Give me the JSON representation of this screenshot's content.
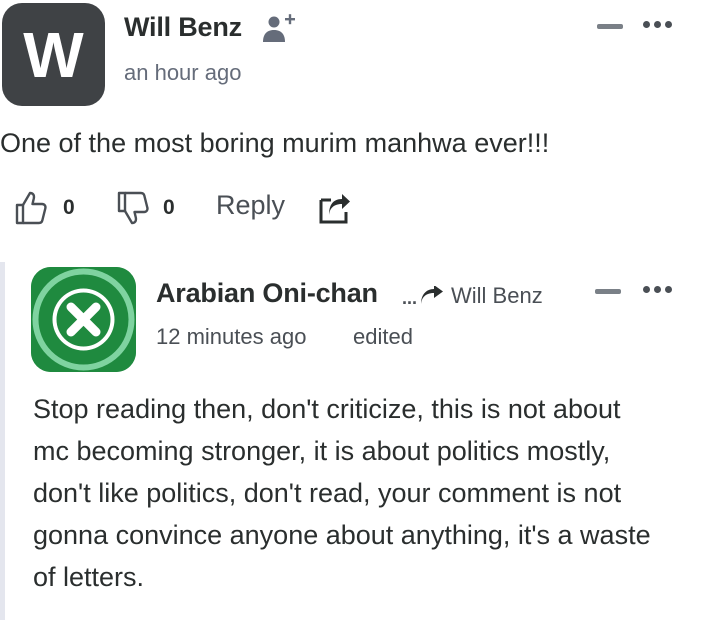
{
  "comment": {
    "avatar_letter": "W",
    "author": "Will Benz",
    "timestamp": "an hour ago",
    "text": "One of the most boring murim manhwa ever!!!",
    "likes": "0",
    "dislikes": "0",
    "reply_label": "Reply",
    "follow_icon": "follow-user-icon",
    "share_icon": "share-icon"
  },
  "reply": {
    "author": "Arabian Oni-chan",
    "reply_to_prefix": "...",
    "reply_to": "Will Benz",
    "timestamp": "12 minutes ago",
    "edited_label": "edited",
    "avatar_icon": "close-x-icon",
    "text_lines": [
      "Stop reading then, don't criticize, this is not about",
      "mc becoming stronger, it is about politics mostly,",
      "don't like politics, don't read, your comment is not",
      "gonna convince anyone about anything, it's a waste",
      "of letters."
    ]
  },
  "colors": {
    "avatar_dark": "#3f4245",
    "avatar_green": "#1f8a3f",
    "text": "#2a2e2e",
    "muted": "#656c7a",
    "rail": "#e4e6ee"
  }
}
